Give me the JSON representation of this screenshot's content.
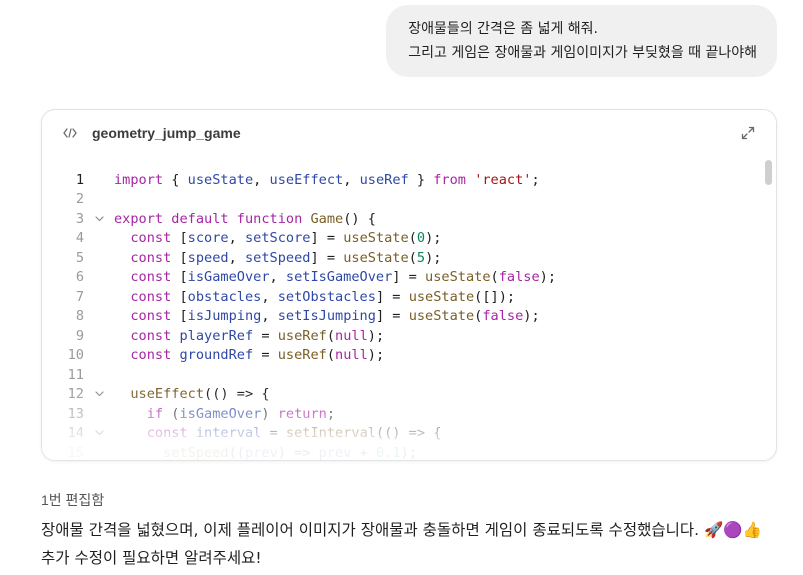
{
  "user_message": {
    "line1": "장애물들의 간격은 좀 넓게 해줘.",
    "line2": "그리고 게임은 장애물과 게임이미지가 부딪혔을 때 끝나야해"
  },
  "artifact": {
    "title": "geometry_jump_game",
    "icon": "code-icon",
    "expand_icon": "expand-icon",
    "lines": [
      {
        "n": "1",
        "fold": false,
        "tokens": [
          {
            "t": "import",
            "c": "kw"
          },
          {
            "t": " { ",
            "c": "plain"
          },
          {
            "t": "useState",
            "c": "var"
          },
          {
            "t": ", ",
            "c": "plain"
          },
          {
            "t": "useEffect",
            "c": "var"
          },
          {
            "t": ", ",
            "c": "plain"
          },
          {
            "t": "useRef",
            "c": "var"
          },
          {
            "t": " } ",
            "c": "plain"
          },
          {
            "t": "from",
            "c": "kw"
          },
          {
            "t": " ",
            "c": "plain"
          },
          {
            "t": "'react'",
            "c": "str"
          },
          {
            "t": ";",
            "c": "plain"
          }
        ]
      },
      {
        "n": "2",
        "fold": false,
        "tokens": []
      },
      {
        "n": "3",
        "fold": true,
        "tokens": [
          {
            "t": "export",
            "c": "kw"
          },
          {
            "t": " ",
            "c": "plain"
          },
          {
            "t": "default",
            "c": "kw"
          },
          {
            "t": " ",
            "c": "plain"
          },
          {
            "t": "function",
            "c": "kw"
          },
          {
            "t": " ",
            "c": "plain"
          },
          {
            "t": "Game",
            "c": "fn"
          },
          {
            "t": "() {",
            "c": "plain"
          }
        ]
      },
      {
        "n": "4",
        "fold": false,
        "tokens": [
          {
            "t": "  ",
            "c": "plain"
          },
          {
            "t": "const",
            "c": "kw"
          },
          {
            "t": " [",
            "c": "plain"
          },
          {
            "t": "score",
            "c": "var"
          },
          {
            "t": ", ",
            "c": "plain"
          },
          {
            "t": "setScore",
            "c": "var"
          },
          {
            "t": "] = ",
            "c": "plain"
          },
          {
            "t": "useState",
            "c": "fn"
          },
          {
            "t": "(",
            "c": "plain"
          },
          {
            "t": "0",
            "c": "num"
          },
          {
            "t": ");",
            "c": "plain"
          }
        ]
      },
      {
        "n": "5",
        "fold": false,
        "tokens": [
          {
            "t": "  ",
            "c": "plain"
          },
          {
            "t": "const",
            "c": "kw"
          },
          {
            "t": " [",
            "c": "plain"
          },
          {
            "t": "speed",
            "c": "var"
          },
          {
            "t": ", ",
            "c": "plain"
          },
          {
            "t": "setSpeed",
            "c": "var"
          },
          {
            "t": "] = ",
            "c": "plain"
          },
          {
            "t": "useState",
            "c": "fn"
          },
          {
            "t": "(",
            "c": "plain"
          },
          {
            "t": "5",
            "c": "num"
          },
          {
            "t": ");",
            "c": "plain"
          }
        ]
      },
      {
        "n": "6",
        "fold": false,
        "tokens": [
          {
            "t": "  ",
            "c": "plain"
          },
          {
            "t": "const",
            "c": "kw"
          },
          {
            "t": " [",
            "c": "plain"
          },
          {
            "t": "isGameOver",
            "c": "var"
          },
          {
            "t": ", ",
            "c": "plain"
          },
          {
            "t": "setIsGameOver",
            "c": "var"
          },
          {
            "t": "] = ",
            "c": "plain"
          },
          {
            "t": "useState",
            "c": "fn"
          },
          {
            "t": "(",
            "c": "plain"
          },
          {
            "t": "false",
            "c": "kw"
          },
          {
            "t": ");",
            "c": "plain"
          }
        ]
      },
      {
        "n": "7",
        "fold": false,
        "tokens": [
          {
            "t": "  ",
            "c": "plain"
          },
          {
            "t": "const",
            "c": "kw"
          },
          {
            "t": " [",
            "c": "plain"
          },
          {
            "t": "obstacles",
            "c": "var"
          },
          {
            "t": ", ",
            "c": "plain"
          },
          {
            "t": "setObstacles",
            "c": "var"
          },
          {
            "t": "] = ",
            "c": "plain"
          },
          {
            "t": "useState",
            "c": "fn"
          },
          {
            "t": "([]);",
            "c": "plain"
          }
        ]
      },
      {
        "n": "8",
        "fold": false,
        "tokens": [
          {
            "t": "  ",
            "c": "plain"
          },
          {
            "t": "const",
            "c": "kw"
          },
          {
            "t": " [",
            "c": "plain"
          },
          {
            "t": "isJumping",
            "c": "var"
          },
          {
            "t": ", ",
            "c": "plain"
          },
          {
            "t": "setIsJumping",
            "c": "var"
          },
          {
            "t": "] = ",
            "c": "plain"
          },
          {
            "t": "useState",
            "c": "fn"
          },
          {
            "t": "(",
            "c": "plain"
          },
          {
            "t": "false",
            "c": "kw"
          },
          {
            "t": ");",
            "c": "plain"
          }
        ]
      },
      {
        "n": "9",
        "fold": false,
        "tokens": [
          {
            "t": "  ",
            "c": "plain"
          },
          {
            "t": "const",
            "c": "kw"
          },
          {
            "t": " ",
            "c": "plain"
          },
          {
            "t": "playerRef",
            "c": "var"
          },
          {
            "t": " = ",
            "c": "plain"
          },
          {
            "t": "useRef",
            "c": "fn"
          },
          {
            "t": "(",
            "c": "plain"
          },
          {
            "t": "null",
            "c": "kw"
          },
          {
            "t": ");",
            "c": "plain"
          }
        ]
      },
      {
        "n": "10",
        "fold": false,
        "tokens": [
          {
            "t": "  ",
            "c": "plain"
          },
          {
            "t": "const",
            "c": "kw"
          },
          {
            "t": " ",
            "c": "plain"
          },
          {
            "t": "groundRef",
            "c": "var"
          },
          {
            "t": " = ",
            "c": "plain"
          },
          {
            "t": "useRef",
            "c": "fn"
          },
          {
            "t": "(",
            "c": "plain"
          },
          {
            "t": "null",
            "c": "kw"
          },
          {
            "t": ");",
            "c": "plain"
          }
        ]
      },
      {
        "n": "11",
        "fold": false,
        "tokens": []
      },
      {
        "n": "12",
        "fold": true,
        "tokens": [
          {
            "t": "  ",
            "c": "plain"
          },
          {
            "t": "useEffect",
            "c": "fn"
          },
          {
            "t": "(() => {",
            "c": "plain"
          }
        ]
      },
      {
        "n": "13",
        "fold": false,
        "tokens": [
          {
            "t": "    ",
            "c": "plain"
          },
          {
            "t": "if",
            "c": "kw"
          },
          {
            "t": " (",
            "c": "plain"
          },
          {
            "t": "isGameOver",
            "c": "var"
          },
          {
            "t": ") ",
            "c": "plain"
          },
          {
            "t": "return",
            "c": "kw"
          },
          {
            "t": ";",
            "c": "plain"
          }
        ]
      },
      {
        "n": "14",
        "fold": true,
        "tokens": [
          {
            "t": "    ",
            "c": "plain"
          },
          {
            "t": "const",
            "c": "kw"
          },
          {
            "t": " ",
            "c": "plain"
          },
          {
            "t": "interval",
            "c": "var"
          },
          {
            "t": " = ",
            "c": "plain"
          },
          {
            "t": "setInterval",
            "c": "fn"
          },
          {
            "t": "(() => {",
            "c": "plain"
          }
        ]
      },
      {
        "n": "15",
        "fold": false,
        "tokens": [
          {
            "t": "      ",
            "c": "plain"
          },
          {
            "t": "setSpeed",
            "c": "fn"
          },
          {
            "t": "((",
            "c": "plain"
          },
          {
            "t": "prev",
            "c": "var"
          },
          {
            "t": ") => ",
            "c": "plain"
          },
          {
            "t": "prev",
            "c": "var"
          },
          {
            "t": " + ",
            "c": "plain"
          },
          {
            "t": "0.1",
            "c": "num"
          },
          {
            "t": ");",
            "c": "plain"
          }
        ]
      }
    ]
  },
  "response": {
    "edit_label": "1번 편집함",
    "text": "장애물 간격을 넓혔으며, 이제 플레이어 이미지가 장애물과 충돌하면 게임이 종료되도록 수정했습니다. 🚀🟣👍 추가 수정이 필요하면 알려주세요!"
  }
}
